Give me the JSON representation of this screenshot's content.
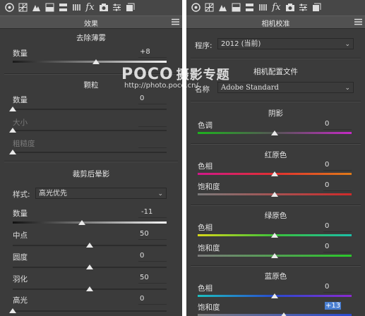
{
  "left": {
    "title": "效果",
    "dehaze": {
      "section": "去除薄雾",
      "amount_label": "数量",
      "amount_value": "+8",
      "amount_level": 0.54
    },
    "grain": {
      "section": "颗粒",
      "amount_label": "数量",
      "amount_value": "0",
      "amount_level": 0.0,
      "size_label": "大小",
      "roughness_label": "粗糙度"
    },
    "vignette": {
      "section": "裁剪后晕影",
      "style_label": "样式:",
      "style_value": "高光优先",
      "amount_label": "数量",
      "amount_value": "-11",
      "amount_level": 0.45,
      "midpoint_label": "中点",
      "midpoint_value": "50",
      "midpoint_level": 0.5,
      "roundness_label": "圆度",
      "roundness_value": "0",
      "roundness_level": 0.5,
      "feather_label": "羽化",
      "feather_value": "50",
      "feather_level": 0.5,
      "highlights_label": "高光",
      "highlights_value": "0",
      "highlights_level": 0.0
    }
  },
  "right": {
    "title": "相机校准",
    "process_label": "程序:",
    "process_value": "2012 (当前)",
    "profile": {
      "section": "相机配置文件",
      "name_label": "名称",
      "name_value": "Adobe Standard"
    },
    "shadows": {
      "section": "阴影",
      "tint_label": "色调",
      "tint_value": "0",
      "tint_level": 0.5
    },
    "red": {
      "section": "红原色",
      "hue_label": "色相",
      "hue_value": "0",
      "hue_level": 0.5,
      "sat_label": "饱和度",
      "sat_value": "0",
      "sat_level": 0.5
    },
    "green": {
      "section": "绿原色",
      "hue_label": "色相",
      "hue_value": "0",
      "hue_level": 0.5,
      "sat_label": "饱和度",
      "sat_value": "0",
      "sat_level": 0.5
    },
    "blue": {
      "section": "蓝原色",
      "hue_label": "色相",
      "hue_value": "0",
      "hue_level": 0.5,
      "sat_label": "饱和度",
      "sat_value": "+13",
      "sat_level": 0.56
    }
  },
  "watermark": {
    "logo": "POCO",
    "logo_cn": "摄影专题",
    "url": "http://photo.poco.cn/"
  },
  "toolbar_icons": [
    "basic-circle-icon",
    "tone-curve-grid-icon",
    "mountain-icon",
    "hsl-icon",
    "split-toning-icon",
    "detail-icon",
    "fx-icon",
    "camera-icon",
    "sliders-icon",
    "presets-icon"
  ],
  "colors": {
    "panel": "#3b3b3b",
    "toolbar": "#474747",
    "titlebar": "#515151",
    "highlight": "#4a7fd1"
  }
}
